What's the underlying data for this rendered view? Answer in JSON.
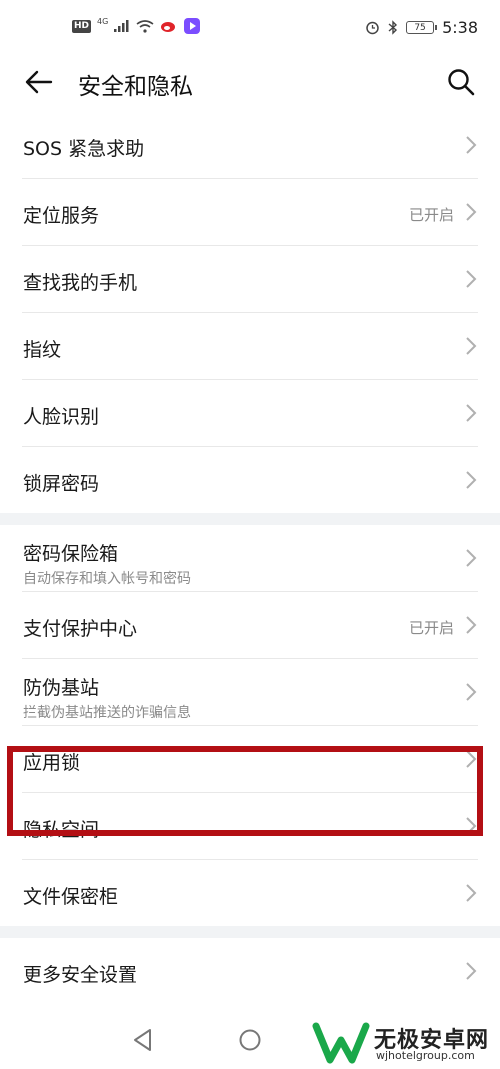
{
  "status_bar": {
    "hd": "HD",
    "network": "4G",
    "battery": "75",
    "time": "5:38"
  },
  "header": {
    "title": "安全和隐私"
  },
  "sections": [
    {
      "items": [
        {
          "title": "SOS 紧急求助"
        },
        {
          "title": "定位服务",
          "status": "已开启"
        },
        {
          "title": "查找我的手机"
        },
        {
          "title": "指纹"
        },
        {
          "title": "人脸识别"
        },
        {
          "title": "锁屏密码"
        }
      ]
    },
    {
      "items": [
        {
          "title": "密码保险箱",
          "subtitle": "自动保存和填入帐号和密码"
        },
        {
          "title": "支付保护中心",
          "status": "已开启"
        },
        {
          "title": "防伪基站",
          "subtitle": "拦截伪基站推送的诈骗信息"
        },
        {
          "title": "应用锁"
        },
        {
          "title": "隐私空间"
        },
        {
          "title": "文件保密柜"
        }
      ]
    },
    {
      "items": [
        {
          "title": "更多安全设置"
        }
      ]
    }
  ],
  "highlight_color": "#b30f14",
  "watermark": {
    "name": "无极安卓网",
    "url": "wjhotelgroup.com"
  },
  "icons": {
    "back": "arrow-left-icon",
    "search": "search-icon",
    "chevron": "chevron-right-icon",
    "nav_back": "triangle-back-icon",
    "nav_home": "circle-home-icon"
  }
}
